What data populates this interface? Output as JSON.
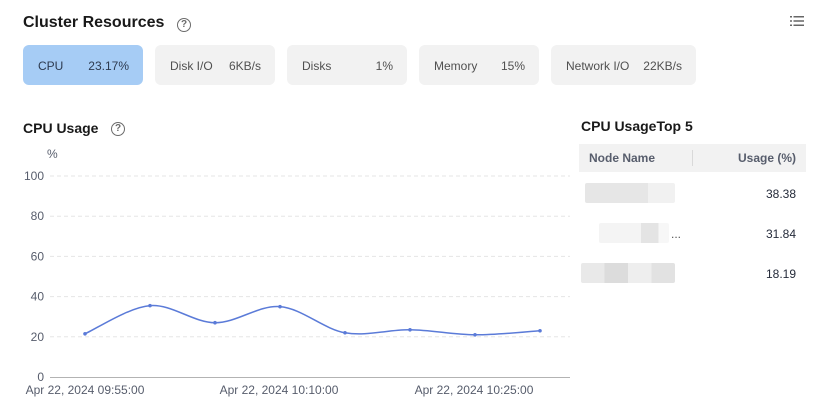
{
  "header": {
    "title": "Cluster Resources",
    "help_icon": "question-circle-icon",
    "menu_icon": "list-icon"
  },
  "metric_cards": [
    {
      "label": "CPU",
      "value": "23.17%",
      "active": true
    },
    {
      "label": "Disk I/O",
      "value": "6KB/s",
      "active": false
    },
    {
      "label": "Disks",
      "value": "1%",
      "active": false
    },
    {
      "label": "Memory",
      "value": "15%",
      "active": false
    },
    {
      "label": "Network I/O",
      "value": "22KB/s",
      "active": false
    }
  ],
  "cpu_usage": {
    "title": "CPU Usage",
    "unit_label": "%"
  },
  "chart_data": {
    "type": "line",
    "title": "CPU Usage",
    "ylabel": "%",
    "ylim": [
      0,
      100
    ],
    "yticks": [
      "100",
      "80",
      "60",
      "40",
      "20",
      "0"
    ],
    "xtick_labels": [
      "Apr 22, 2024 09:55:00",
      "Apr 22, 2024 10:10:00",
      "Apr 22, 2024 10:25:00"
    ],
    "x": [
      "09:55:00",
      "09:58:00",
      "10:01:00",
      "10:04:00",
      "10:07:00",
      "10:10:00",
      "10:13:00",
      "10:16:00",
      "10:19:00",
      "10:22:00"
    ],
    "series": [
      {
        "values": [
          21.5,
          35.5,
          27,
          35,
          22,
          23.5,
          21,
          23
        ]
      }
    ],
    "grid": true,
    "color": "#5b7bd8"
  },
  "top5": {
    "title": "CPU UsageTop 5",
    "headers": [
      "Node Name",
      "Usage (%)"
    ],
    "rows": [
      {
        "node": "",
        "value": "38.38"
      },
      {
        "node": "...",
        "value": "31.84"
      },
      {
        "node": "",
        "value": "18.19"
      }
    ]
  }
}
